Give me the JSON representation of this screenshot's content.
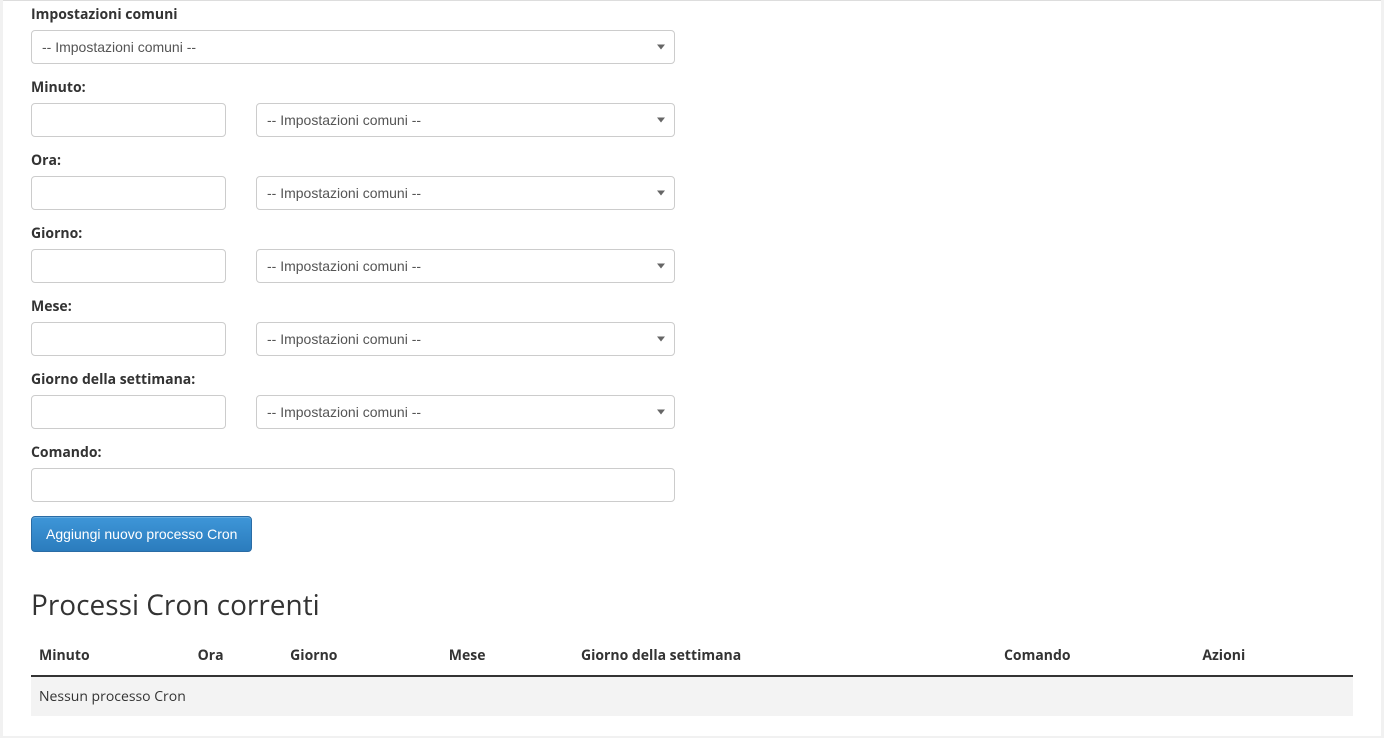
{
  "form": {
    "common_settings": {
      "label": "Impostazioni comuni",
      "placeholder": "-- Impostazioni comuni --"
    },
    "minute": {
      "label": "Minuto:",
      "value": "",
      "select_placeholder": "-- Impostazioni comuni --"
    },
    "hour": {
      "label": "Ora:",
      "value": "",
      "select_placeholder": "-- Impostazioni comuni --"
    },
    "day": {
      "label": "Giorno:",
      "value": "",
      "select_placeholder": "-- Impostazioni comuni --"
    },
    "month": {
      "label": "Mese:",
      "value": "",
      "select_placeholder": "-- Impostazioni comuni --"
    },
    "weekday": {
      "label": "Giorno della settimana:",
      "value": "",
      "select_placeholder": "-- Impostazioni comuni --"
    },
    "command": {
      "label": "Comando:",
      "value": ""
    },
    "submit_label": "Aggiungi nuovo processo Cron"
  },
  "current_section": {
    "title": "Processi Cron correnti",
    "columns": {
      "minute": "Minuto",
      "hour": "Ora",
      "day": "Giorno",
      "month": "Mese",
      "weekday": "Giorno della settimana",
      "command": "Comando",
      "actions": "Azioni"
    },
    "empty_message": "Nessun processo Cron"
  }
}
